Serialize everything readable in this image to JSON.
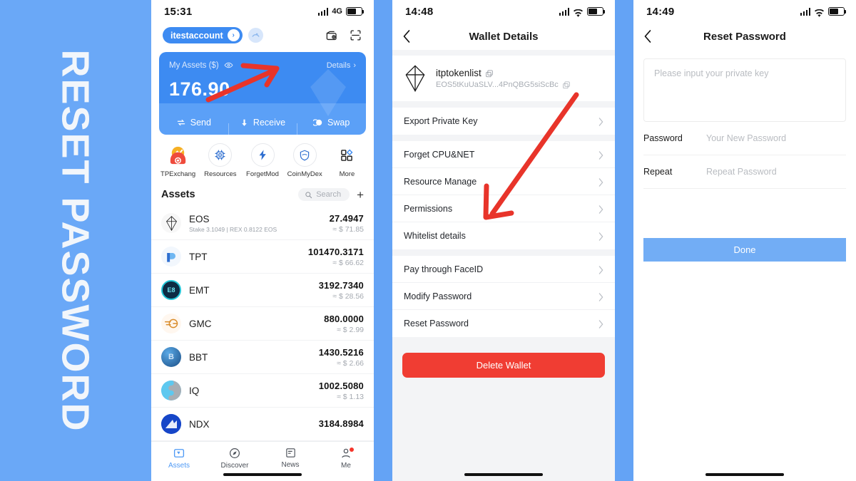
{
  "banner": {
    "text": "RESET PASSWORD",
    "background": "#6aa8f7",
    "text_color": "#f2f6fb"
  },
  "screen1": {
    "status": {
      "time": "15:31",
      "network": "4G",
      "battery_icon": "battery-icon",
      "signal_icon": "signal-bars-icon"
    },
    "header": {
      "account": "itestaccount",
      "caret_icon": "chevron-right-icon",
      "avatar_icon": "account-avatar-icon",
      "wallet_icon": "wallet-add-icon",
      "scan_icon": "scan-qr-icon"
    },
    "card": {
      "title": "My Assets ($)",
      "eye_icon": "eye-icon",
      "details_label": "Details",
      "details_chevron": "chevron-right-icon",
      "amount": "176.90",
      "actions": [
        {
          "label": "Send",
          "icon": "send-swap-icon"
        },
        {
          "label": "Receive",
          "icon": "arrow-down-icon"
        },
        {
          "label": "Swap",
          "icon": "swap-circle-icon"
        }
      ]
    },
    "quick_actions": [
      {
        "label": "TPExchang",
        "icon": "tpexchange-icon"
      },
      {
        "label": "Resources",
        "icon": "cpu-chip-icon"
      },
      {
        "label": "ForgetMod",
        "icon": "lightning-icon"
      },
      {
        "label": "CoinMyDex",
        "icon": "shield-icon"
      },
      {
        "label": "More",
        "icon": "grid-more-icon"
      }
    ],
    "assets_section": {
      "title": "Assets",
      "search_placeholder": "Search",
      "search_icon": "search-icon",
      "add_label": "+"
    },
    "assets": [
      {
        "symbol": "EOS",
        "sub": "Stake 3.1049  |  REX 0.8122 EOS",
        "amount": "27.4947",
        "usd": "≈ $ 71.85",
        "icon": "eos-coin-icon"
      },
      {
        "symbol": "TPT",
        "sub": "",
        "amount": "101470.3171",
        "usd": "≈ $ 66.62",
        "icon": "tpt-coin-icon"
      },
      {
        "symbol": "EMT",
        "sub": "",
        "amount": "3192.7340",
        "usd": "≈ $ 28.56",
        "icon": "emt-coin-icon"
      },
      {
        "symbol": "GMC",
        "sub": "",
        "amount": "880.0000",
        "usd": "≈ $ 2.99",
        "icon": "gmc-coin-icon"
      },
      {
        "symbol": "BBT",
        "sub": "",
        "amount": "1430.5216",
        "usd": "≈ $ 2.66",
        "icon": "bbt-coin-icon"
      },
      {
        "symbol": "IQ",
        "sub": "",
        "amount": "1002.5080",
        "usd": "≈ $ 1.13",
        "icon": "iq-coin-icon"
      },
      {
        "symbol": "NDX",
        "sub": "",
        "amount": "3184.8984",
        "usd": "",
        "icon": "ndx-coin-icon"
      }
    ],
    "tabs": [
      {
        "label": "Assets",
        "icon": "assets-icon",
        "active": true
      },
      {
        "label": "Discover",
        "icon": "compass-icon",
        "active": false
      },
      {
        "label": "News",
        "icon": "news-icon",
        "active": false
      },
      {
        "label": "Me",
        "icon": "person-icon",
        "active": false,
        "badge": true
      }
    ]
  },
  "screen2": {
    "status": {
      "time": "14:48",
      "wifi_icon": "wifi-icon",
      "signal_icon": "signal-bars-icon",
      "battery_icon": "battery-icon"
    },
    "nav": {
      "title": "Wallet Details",
      "back_icon": "chevron-left-icon"
    },
    "wallet": {
      "name": "itptokenlist",
      "address": "EOS5tKuUaSLV...4PnQBG5siScBc",
      "logo_icon": "eos-logo-icon",
      "copy_name_icon": "copy-icon",
      "copy_address_icon": "copy-icon"
    },
    "menu_group_1": [
      {
        "label": "Export Private Key"
      }
    ],
    "menu_group_2": [
      {
        "label": "Forget CPU&NET"
      },
      {
        "label": "Resource Manage"
      },
      {
        "label": "Permissions"
      },
      {
        "label": "Whitelist details"
      }
    ],
    "menu_group_3": [
      {
        "label": "Pay through FaceID"
      },
      {
        "label": "Modify Password"
      },
      {
        "label": "Reset Password"
      }
    ],
    "delete_button": "Delete Wallet",
    "delete_color": "#f03d33"
  },
  "screen3": {
    "status": {
      "time": "14:49",
      "wifi_icon": "wifi-icon",
      "signal_icon": "signal-bars-icon",
      "battery_icon": "battery-icon"
    },
    "nav": {
      "title": "Reset Password",
      "back_icon": "chevron-left-icon"
    },
    "private_key_placeholder": "Please input your private key",
    "fields": [
      {
        "label": "Password",
        "placeholder": "Your New Password",
        "value": ""
      },
      {
        "label": "Repeat",
        "placeholder": "Repeat Password",
        "value": ""
      }
    ],
    "done_button": "Done",
    "done_color": "#72adf5"
  },
  "annotations": {
    "arrow_color": "#e8342a",
    "arrow_1_target": "Details",
    "arrow_2_target": "Reset Password"
  }
}
